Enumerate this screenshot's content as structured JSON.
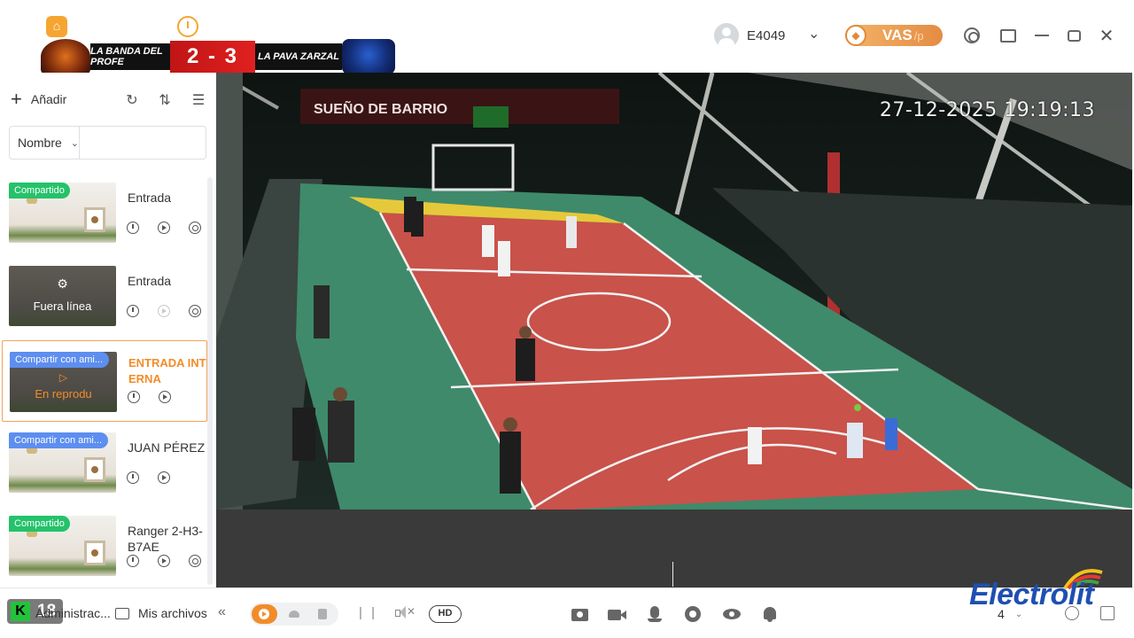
{
  "scoreboard": {
    "team_left": "LA BANDA DEL PROFE",
    "score": "2 - 3",
    "team_right": "LA PAVA ZARZAL"
  },
  "header": {
    "user": "E4049",
    "vas_label": "VAS",
    "vas_sub": "/p"
  },
  "sidebar": {
    "add_label": "Añadir",
    "filter_label": "Nombre",
    "search_placeholder": "",
    "cameras": [
      {
        "name": "Entrada",
        "badge": "Compartido",
        "badge_type": "shared",
        "status": "",
        "active": false
      },
      {
        "name": "Entrada",
        "badge": "",
        "badge_type": "",
        "status": "Fuera línea",
        "active": false
      },
      {
        "name": "ENTRADA INTERNA",
        "badge": "Compartir con ami...",
        "badge_type": "friends",
        "status": "En reprodu",
        "active": true
      },
      {
        "name": "JUAN PÉREZ",
        "badge": "Compartir con ami...",
        "badge_type": "friends",
        "status": "",
        "active": false
      },
      {
        "name": "Ranger 2-H3-B7AE",
        "badge": "Compartido",
        "badge_type": "shared",
        "status": "",
        "active": false
      }
    ]
  },
  "video": {
    "timestamp": "27-12-2025 19:19:13",
    "banner_text": "SUEÑO DE BARRIO"
  },
  "bottombar": {
    "admin_num": "18",
    "admin_label": "Administrac...",
    "files_label": "Mis archivos",
    "hd_label": "HD",
    "layout_value": "4"
  },
  "watermark": "Electrolit",
  "colors": {
    "accent": "#f28c28",
    "shared_badge": "#24c26a",
    "friends_badge": "#5d8ef0",
    "court_red": "#c9524a",
    "court_green": "#3f8a6b"
  }
}
